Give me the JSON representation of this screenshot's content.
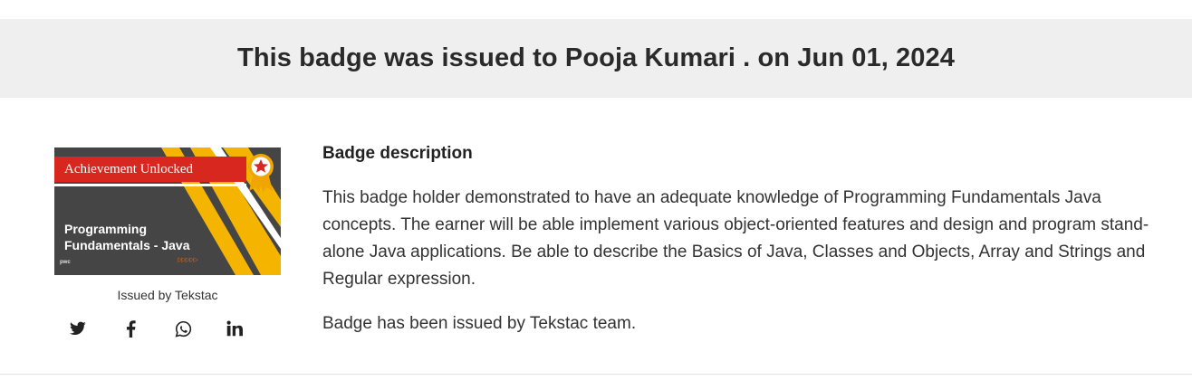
{
  "banner": {
    "text": "This badge was issued to Pooja Kumari . on Jun 01, 2024"
  },
  "badge": {
    "ribbon_text": "Achievement Unlocked",
    "title_line1": "Programming",
    "title_line2": "Fundamentals - Java",
    "logo_text": "pwc",
    "issued_by": "Issued by Tekstac",
    "colors": {
      "background": "#454545",
      "stripe": "#f5b400",
      "ribbon": "#d8271f",
      "medal": "#f0a500"
    }
  },
  "share": [
    {
      "name": "twitter-icon"
    },
    {
      "name": "facebook-icon"
    },
    {
      "name": "whatsapp-icon"
    },
    {
      "name": "linkedin-icon"
    }
  ],
  "description": {
    "heading": "Badge description",
    "body": "This badge holder demonstrated to have an adequate knowledge of Programming Fundamentals Java concepts. The earner will be able implement various object-oriented features and design and program stand-alone Java applications. Be able to describe the Basics of Java, Classes and Objects, Array and Strings and Regular expression.",
    "issued_note": "Badge has been issued by Tekstac team."
  }
}
